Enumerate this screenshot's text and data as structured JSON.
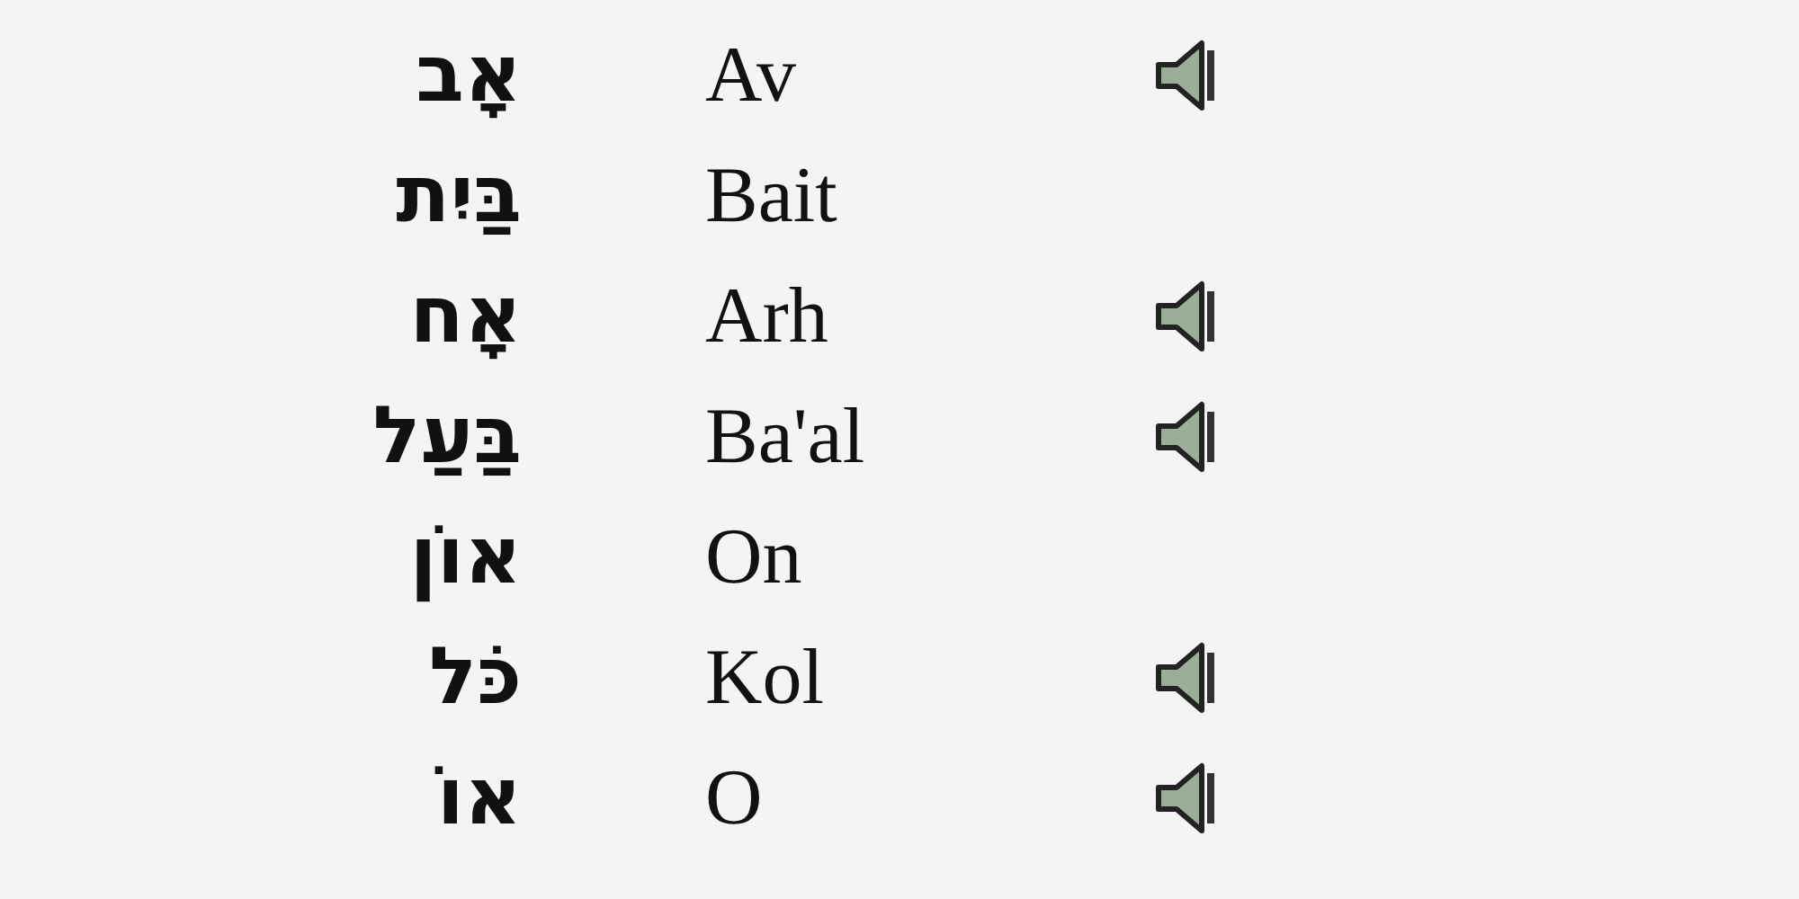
{
  "words": [
    {
      "hebrew": "אָב",
      "transliteration": "Av",
      "audio": true
    },
    {
      "hebrew": "בַּיִת",
      "transliteration": "Bait",
      "audio": false
    },
    {
      "hebrew": "אָח",
      "transliteration": "Arh",
      "audio": true
    },
    {
      "hebrew": "בַּעַל",
      "transliteration": "Ba'al",
      "audio": true
    },
    {
      "hebrew": "אוֹן",
      "transliteration": "On",
      "audio": false
    },
    {
      "hebrew": "כֹּל",
      "transliteration": "Kol",
      "audio": true
    },
    {
      "hebrew": "אוֹ",
      "transliteration": "O",
      "audio": true
    }
  ]
}
